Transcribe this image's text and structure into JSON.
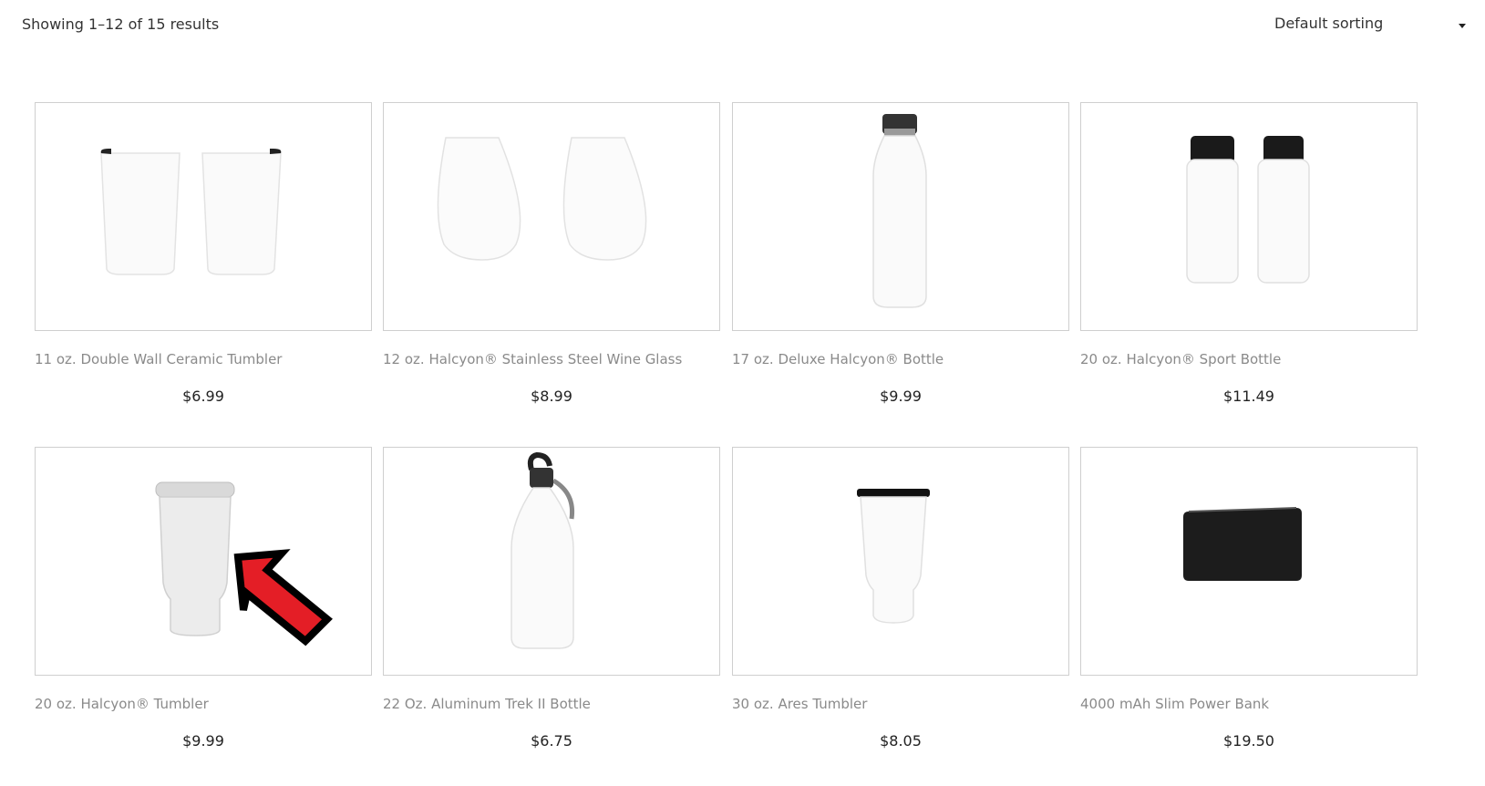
{
  "result_count": "Showing 1–12 of 15 results",
  "sorting": {
    "selected": "Default sorting"
  },
  "products": [
    {
      "title": "11 oz. Double Wall Ceramic Tumbler",
      "price": "$6.99",
      "icon": "ceramic-tumbler-icon"
    },
    {
      "title": "12 oz. Halcyon® Stainless Steel Wine Glass",
      "price": "$8.99",
      "icon": "wine-glass-icon"
    },
    {
      "title": "17 oz. Deluxe Halcyon® Bottle",
      "price": "$9.99",
      "icon": "bottle-icon"
    },
    {
      "title": "20 oz. Halcyon® Sport Bottle",
      "price": "$11.49",
      "icon": "sport-bottle-icon"
    },
    {
      "title": "20 oz. Halcyon® Tumbler",
      "price": "$9.99",
      "icon": "tumbler-icon"
    },
    {
      "title": "22 Oz. Aluminum Trek II Bottle",
      "price": "$6.75",
      "icon": "aluminum-bottle-icon"
    },
    {
      "title": "30 oz. Ares Tumbler",
      "price": "$8.05",
      "icon": "ares-tumbler-icon"
    },
    {
      "title": "4000 mAh Slim Power Bank",
      "price": "$19.50",
      "icon": "power-bank-icon"
    }
  ],
  "colors": {
    "arrow_fill": "#e41e26",
    "arrow_stroke": "#000000",
    "border": "#cfcfcf"
  }
}
